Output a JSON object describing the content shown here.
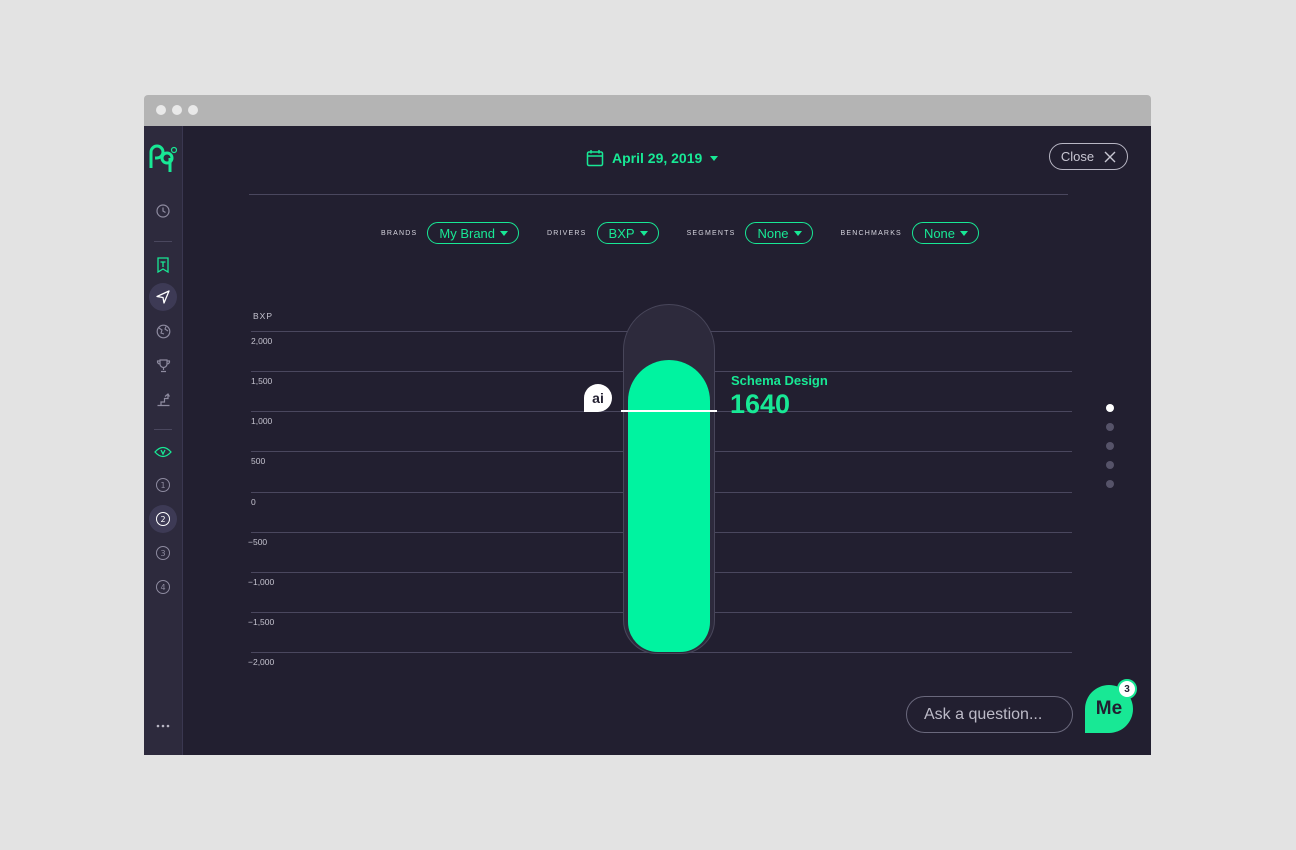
{
  "colors": {
    "accent": "#18e895",
    "bar": "#00f3a0",
    "background": "#221f30",
    "sidebar": "#2d2a3d"
  },
  "sidebar": {
    "logo_icon": "rq-logo",
    "items": [
      {
        "icon": "clock-icon"
      },
      {
        "icon": "bookmark-t-icon"
      },
      {
        "icon": "navigation-arrow-icon",
        "active": true
      },
      {
        "icon": "globe-icon"
      },
      {
        "icon": "trophy-icon"
      },
      {
        "icon": "stairs-icon"
      },
      {
        "icon": "eye-v-icon"
      },
      {
        "label": "1"
      },
      {
        "label": "2",
        "active": true
      },
      {
        "label": "3"
      },
      {
        "label": "4"
      }
    ],
    "more_icon": "more-dots-icon"
  },
  "header": {
    "date": "April 29, 2019",
    "close_label": "Close"
  },
  "filters": [
    {
      "label": "BRANDS",
      "value": "My Brand"
    },
    {
      "label": "DRIVERS",
      "value": "BXP"
    },
    {
      "label": "SEGMENTS",
      "value": "None"
    },
    {
      "label": "BENCHMARKS",
      "value": "None"
    }
  ],
  "chart_data": {
    "type": "bar",
    "ylabel": "BXP",
    "ylim": [
      -2000,
      2000
    ],
    "yticks": [
      "2,000",
      "1,500",
      "1,000",
      "500",
      "0",
      "−500",
      "−1,000",
      "−1,500",
      "−2,000"
    ],
    "categories": [
      "Schema Design"
    ],
    "values": [
      1640
    ],
    "value_label": "1640",
    "ai_benchmark": 1000,
    "ai_label": "ai"
  },
  "pager": {
    "count": 5,
    "active": 0
  },
  "ask": {
    "placeholder": "Ask a question..."
  },
  "me": {
    "label": "Me",
    "count": "3"
  }
}
